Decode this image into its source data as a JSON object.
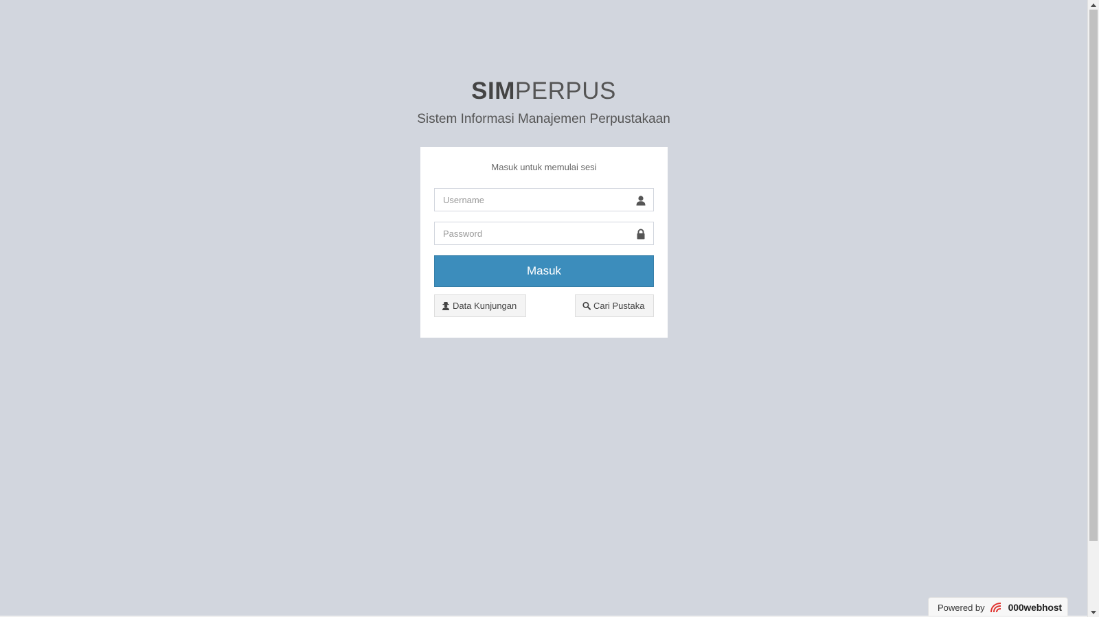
{
  "app": {
    "logo_bold": "SIM",
    "logo_light": "PERPUS",
    "subtitle": "Sistem Informasi Manajemen Perpustakaan"
  },
  "login": {
    "message": "Masuk untuk memulai sesi",
    "username_placeholder": "Username",
    "username_icon": "user-icon",
    "password_placeholder": "Password",
    "password_icon": "lock-icon",
    "submit_label": "Masuk",
    "visits_label": "Data Kunjungan",
    "visits_icon": "user-secret-icon",
    "search_label": "Cari Pustaka",
    "search_icon": "search-icon"
  },
  "footer": {
    "powered_label": "Powered by",
    "brand": "000webhost"
  },
  "colors": {
    "background": "#d2d6de",
    "primary": "#3c8dbc",
    "box": "#ffffff"
  }
}
